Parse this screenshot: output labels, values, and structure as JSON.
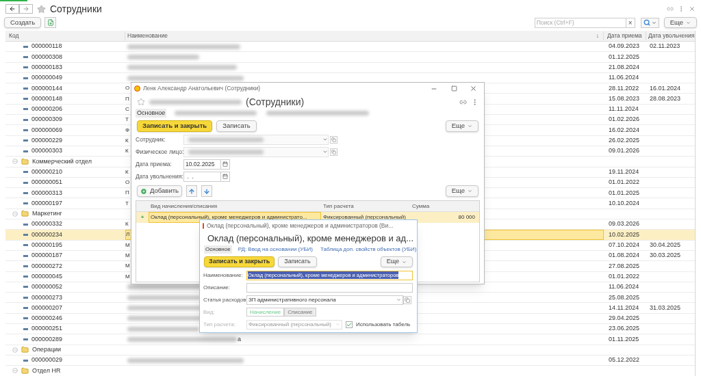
{
  "window": {
    "title": "Сотрудники"
  },
  "toolbar": {
    "create": "Создать",
    "search": {
      "placeholder": "Поиск (Ctrl+F)",
      "clear": "×"
    },
    "more": "Еще"
  },
  "list": {
    "columns": [
      {
        "label": "Код"
      },
      {
        "label": "Наименование",
        "sort": "↓"
      },
      {
        "label": "Дата приема"
      },
      {
        "label": "Дата увольнения"
      }
    ],
    "rows": [
      {
        "kind": "item",
        "code": "000000118",
        "name_blurred": true,
        "hired": "04.09.2023",
        "dismissed": "02.11.2023",
        "selected": false
      },
      {
        "kind": "item",
        "code": "000000308",
        "name_blurred": true,
        "hired": "01.12.2025",
        "selected": false
      },
      {
        "kind": "item",
        "code": "000000183",
        "name_blurred": true,
        "hired": "21.08.2024",
        "selected": false
      },
      {
        "kind": "item",
        "code": "000000049",
        "name_blurred": true,
        "hired": "11.06.2024",
        "selected": false
      },
      {
        "kind": "item",
        "code": "000000144",
        "name": "О",
        "hired": "28.11.2022",
        "dismissed": "16.01.2024",
        "selected": false
      },
      {
        "kind": "item",
        "code": "000000148",
        "name": "П",
        "hired": "15.08.2023",
        "dismissed": "28.08.2023",
        "selected": false
      },
      {
        "kind": "item",
        "code": "000000206",
        "name": "С",
        "hired": "11.11.2024",
        "selected": false
      },
      {
        "kind": "item",
        "code": "000000309",
        "name": "Т",
        "hired": "01.02.2026",
        "selected": false
      },
      {
        "kind": "item",
        "code": "000000069",
        "name": "Ф",
        "hired": "16.02.2024",
        "selected": false
      },
      {
        "kind": "item",
        "code": "000000229",
        "name": "К",
        "hired": "26.02.2025",
        "selected": false
      },
      {
        "kind": "item",
        "code": "000000303",
        "name": "К",
        "hired": "09.01.2026",
        "selected": false
      },
      {
        "kind": "group",
        "name": "Коммерческий отдел",
        "expanded": true,
        "children": [
          {
            "kind": "item",
            "code": "000000210",
            "name": "К",
            "hired": "19.11.2024",
            "selected": false
          },
          {
            "kind": "item",
            "code": "000000051",
            "name": "О",
            "hired": "01.01.2022",
            "selected": false
          },
          {
            "kind": "item",
            "code": "000000313",
            "name": "П",
            "hired": "01.01.2025",
            "selected": false
          },
          {
            "kind": "item",
            "code": "000000197",
            "name": "Т",
            "hired": "10.10.2024",
            "selected": false
          }
        ]
      },
      {
        "kind": "group",
        "name": "Маркетинг",
        "expanded": true,
        "children": [
          {
            "kind": "item",
            "code": "000000332",
            "name": "К",
            "hired": "09.03.2026",
            "selected": false
          },
          {
            "kind": "item",
            "code": "000000234",
            "name": "Л",
            "hired": "10.02.2025",
            "selected": true
          },
          {
            "kind": "item",
            "code": "000000195",
            "name": "М",
            "hired": "07.10.2024",
            "dismissed": "30.04.2025",
            "selected": false
          },
          {
            "kind": "item",
            "code": "000000187",
            "name": "М",
            "hired": "01.08.2024",
            "dismissed": "30.03.2025",
            "selected": false
          },
          {
            "kind": "item",
            "code": "000000272",
            "name": "М",
            "hired": "27.08.2025",
            "selected": false
          },
          {
            "kind": "item",
            "code": "000000045",
            "name": "М",
            "hired": "01.01.2022",
            "selected": false
          },
          {
            "kind": "item",
            "code": "000000052",
            "name_blurred": true,
            "hired": "11.06.2024",
            "selected": false
          },
          {
            "kind": "item",
            "code": "000000273",
            "name_blurred": true,
            "hired": "25.08.2025",
            "selected": false
          },
          {
            "kind": "item",
            "code": "000000207",
            "name_blurred": true,
            "hired": "14.11.2024",
            "dismissed": "31.03.2025",
            "selected": false
          },
          {
            "kind": "item",
            "code": "000000246",
            "name_blurred": true,
            "hired": "29.04.2025",
            "selected": false
          },
          {
            "kind": "item",
            "code": "000000251",
            "name_blurred": true,
            "hired": "23.06.2025",
            "selected": false
          },
          {
            "kind": "item",
            "code": "000000289",
            "name_blurred": true,
            "name_tail": "а",
            "hired": "01.11.2025",
            "selected": false
          }
        ]
      },
      {
        "kind": "group",
        "name": "Операции",
        "expanded": true,
        "children": [
          {
            "kind": "item",
            "code": "000000029",
            "name_blurred": true,
            "hired": "05.12.2022",
            "selected": false
          }
        ]
      },
      {
        "kind": "group",
        "name": "Отдел HR",
        "expanded": true,
        "children": []
      }
    ]
  },
  "employee_form": {
    "window_title": "Ленк Александр Анатольевич (Сотрудники)",
    "heading_blurred": true,
    "heading": "(Сотрудники)",
    "tabs": [
      {
        "label": "Основное",
        "selected": true
      },
      {
        "blurred": true,
        "selected": false
      },
      {
        "blurred": true,
        "selected": false
      }
    ],
    "buttons": {
      "save_close": "Записать и закрыть",
      "save": "Записать",
      "more": "Еще"
    },
    "fields": [
      {
        "label": "Сотрудник:",
        "kind": "select",
        "blurred": true
      },
      {
        "label": "Физическое лицо:",
        "kind": "select",
        "blurred": true
      },
      {
        "label": "Дата приема:",
        "kind": "date",
        "value": "10.02.2025"
      },
      {
        "label": "Дата увольнения:",
        "kind": "date",
        "value": " .  ."
      }
    ],
    "table_toolbar": {
      "add": "Добавить",
      "more": "Еще"
    },
    "table": {
      "columns": [
        "Вид начисления/списания",
        "Тип расчета",
        "Сумма"
      ],
      "rows": [
        {
          "marker": "+",
          "accrual": "Оклад (персональный), кроме менеджеров и администрато...",
          "calc_type": "Фиксированный (персональный)",
          "amount": "80 000",
          "selected": true
        }
      ]
    }
  },
  "accrual_form": {
    "window_title": "Оклад (персональный), кроме менеджеров и администраторов (Ви...",
    "heading": "Оклад (персональный), кроме менеджеров и ад...",
    "tabs": [
      {
        "label": "Основное",
        "selected": true
      },
      {
        "label": "РД: Ввод на основании (УБИ)",
        "selected": false
      },
      {
        "label": "Таблица доп. свойств объектов (УБИ)",
        "selected": false
      }
    ],
    "buttons": {
      "save_close": "Записать и закрыть",
      "save": "Записать",
      "more": "Еще"
    },
    "fields": [
      {
        "kind": "text",
        "label": "Наименование:",
        "value": "Оклад (персональный), кроме менеджеров и администраторов",
        "focused": true
      },
      {
        "kind": "text",
        "label": "Описание:",
        "focused": false
      },
      {
        "kind": "select",
        "label": "Статья расходов:",
        "value": "ЗП административного персонала"
      },
      {
        "kind": "toggle",
        "label": "Вид:",
        "disabled": true,
        "options": [
          {
            "label": "Начисление",
            "selected": true
          },
          {
            "label": "Списание",
            "selected": false
          }
        ]
      },
      {
        "kind": "select_check",
        "label": "Тип расчета:",
        "disabled": true,
        "value": "Фиксированный (персональный)",
        "check": {
          "label": "Использовать табель",
          "checked": true
        }
      }
    ]
  }
}
